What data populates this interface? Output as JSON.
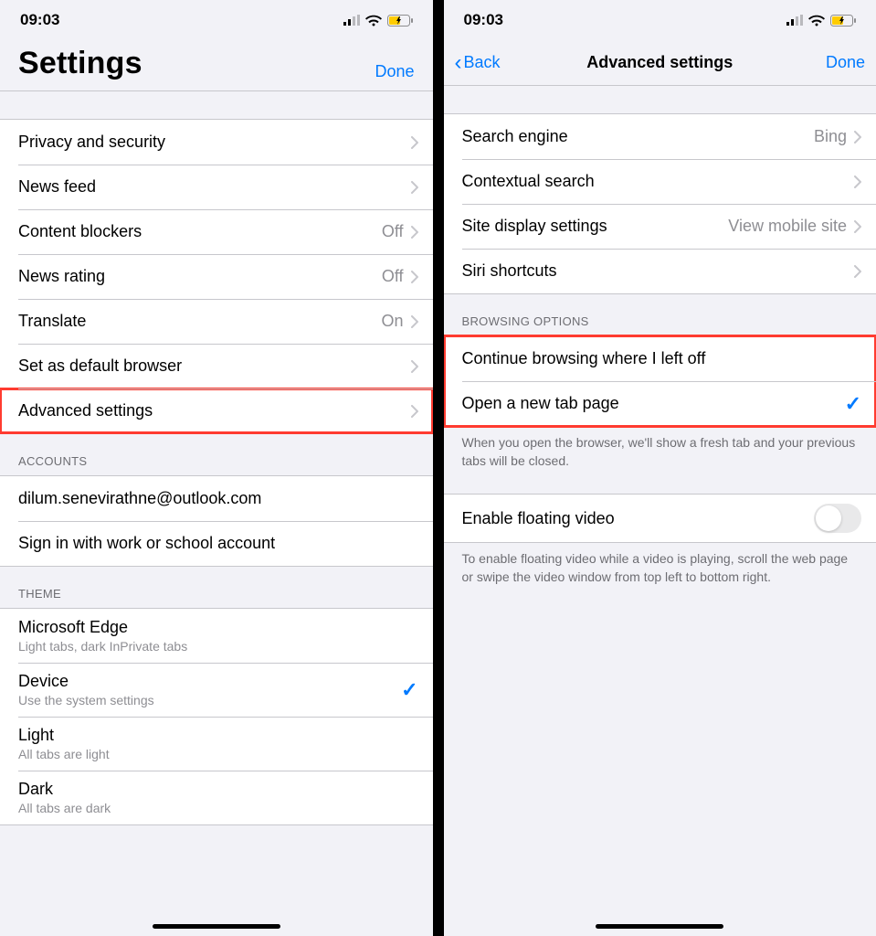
{
  "status": {
    "time": "09:03"
  },
  "left": {
    "title": "Settings",
    "done": "Done",
    "general": [
      {
        "label": "Privacy and security",
        "value": ""
      },
      {
        "label": "News feed",
        "value": ""
      },
      {
        "label": "Content blockers",
        "value": "Off"
      },
      {
        "label": "News rating",
        "value": "Off"
      },
      {
        "label": "Translate",
        "value": "On"
      },
      {
        "label": "Set as default browser",
        "value": ""
      },
      {
        "label": "Advanced settings",
        "value": "",
        "highlight": true
      }
    ],
    "accounts_header": "ACCOUNTS",
    "accounts": [
      {
        "label": "dilum.senevirathne@outlook.com"
      },
      {
        "label": "Sign in with work or school account"
      }
    ],
    "theme_header": "THEME",
    "theme": [
      {
        "label": "Microsoft Edge",
        "sub": "Light tabs, dark InPrivate tabs",
        "checked": false
      },
      {
        "label": "Device",
        "sub": "Use the system settings",
        "checked": true
      },
      {
        "label": "Light",
        "sub": "All tabs are light",
        "checked": false
      },
      {
        "label": "Dark",
        "sub": "All tabs are dark",
        "checked": false
      }
    ]
  },
  "right": {
    "back": "Back",
    "title": "Advanced settings",
    "done": "Done",
    "top": [
      {
        "label": "Search engine",
        "value": "Bing"
      },
      {
        "label": "Contextual search",
        "value": ""
      },
      {
        "label": "Site display settings",
        "value": "View mobile site"
      },
      {
        "label": "Siri shortcuts",
        "value": ""
      }
    ],
    "browsing_header": "BROWSING OPTIONS",
    "browsing": [
      {
        "label": "Continue browsing where I left off",
        "checked": false
      },
      {
        "label": "Open a new tab page",
        "checked": true
      }
    ],
    "browsing_footer": "When you open the browser, we'll show a fresh tab and your previous tabs will be closed.",
    "floating": {
      "label": "Enable floating video",
      "on": false
    },
    "floating_footer": "To enable floating video while a video is playing, scroll the web page or swipe the video window from top left to bottom right."
  }
}
